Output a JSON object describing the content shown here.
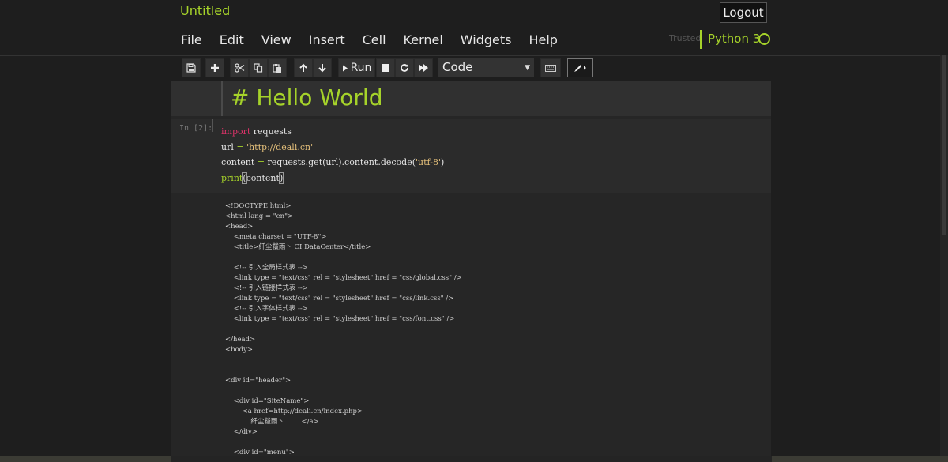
{
  "header": {
    "notebook_title": "Untitled",
    "logout_label": "Logout",
    "trusted_label": "Trusted",
    "kernel_name": "Python 3"
  },
  "menubar": {
    "items": [
      {
        "label": "File"
      },
      {
        "label": "Edit"
      },
      {
        "label": "View"
      },
      {
        "label": "Insert"
      },
      {
        "label": "Cell"
      },
      {
        "label": "Kernel"
      },
      {
        "label": "Widgets"
      },
      {
        "label": "Help"
      }
    ]
  },
  "toolbar": {
    "run_label": "Run",
    "cell_type": "Code",
    "icons": [
      "save-icon",
      "plus-icon",
      "cut-icon",
      "copy-icon",
      "paste-icon",
      "arrow-up-icon",
      "arrow-down-icon",
      "run-icon",
      "stop-icon",
      "restart-icon",
      "fast-forward-icon",
      "keyboard-icon",
      "edit-icon"
    ]
  },
  "markdown_cell": {
    "text": "# Hello World"
  },
  "code_cell": {
    "prompt": "In  [2]:",
    "lines": {
      "l1_kw": "import",
      "l1_rest": " requests",
      "l2_a": "url ",
      "l2_op": "=",
      "l2_sp": " ",
      "l2_str": "'http://deali.cn'",
      "l3_a": "content ",
      "l3_op": "=",
      "l3_b": " requests.get(url).content.decode(",
      "l3_str": "'utf-8'",
      "l3_c": ")",
      "l4_fn": "print",
      "l4_paren": "(",
      "l4_arg": "content",
      "l4_close": ")"
    }
  },
  "output": {
    "lines": [
      "<!DOCTYPE html>",
      "<html lang = \"en\">",
      "<head>",
      "    <meta charset = \"UTF-8\">",
      "    <title>纤尘黻雨丶 CI DataCenter</title>",
      "",
      "    <!-- 引入全局样式表 -->",
      "    <link type = \"text/css\" rel = \"stylesheet\" href = \"css/global.css\" />",
      "    <!-- 引入链接样式表 -->",
      "    <link type = \"text/css\" rel = \"stylesheet\" href = \"css/link.css\" />",
      "    <!-- 引入字体样式表 -->",
      "    <link type = \"text/css\" rel = \"stylesheet\" href = \"css/font.css\" />",
      "",
      "</head>",
      "<body>",
      "",
      "",
      "<div id=\"header\">",
      "",
      "    <div id=\"SiteName\">",
      "        <a href=http://deali.cn/index.php>",
      "            纤尘黻雨丶        </a>",
      "    </div>",
      "",
      "    <div id=\"menu\">"
    ]
  },
  "colors": {
    "accent": "#a6d32a",
    "keyword": "#e0336a",
    "string": "#e5c07b",
    "background": "#1e1e1e"
  }
}
